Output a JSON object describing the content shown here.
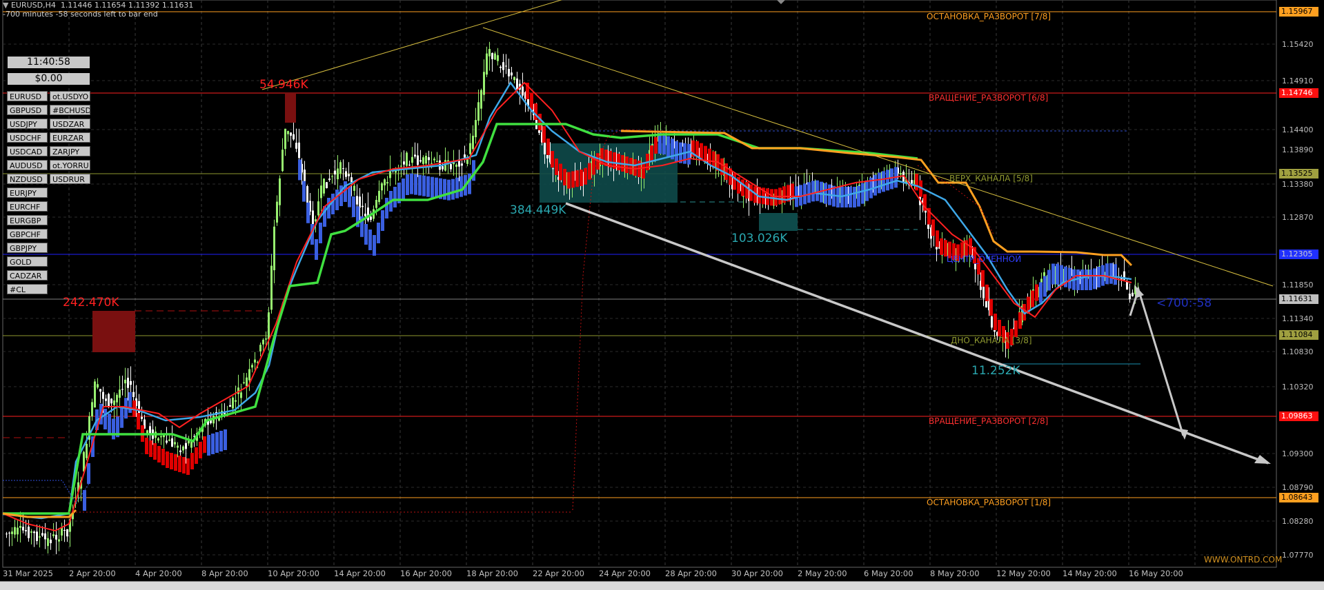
{
  "header": {
    "title": "EURUSD,H4",
    "ohlc": "1.11446 1.11654 1.11392 1.11631",
    "countdown": "-700 minutes -58 seconds left to bar end"
  },
  "panel": {
    "clock": "11:40:58",
    "balance": "$0.00",
    "symbols_col1": [
      "EURUSD",
      "GBPUSD",
      "USDJPY",
      "USDCHF",
      "USDCAD",
      "AUDUSD",
      "NZDUSD",
      "EURJPY",
      "EURCHF",
      "EURGBP",
      "GBPCHF",
      "GBPJPY",
      "GOLD",
      "CADZAR",
      "#CL"
    ],
    "symbols_col2": [
      "ot.USDYO",
      "#BCHUSD",
      "USDZAR",
      "EURZAR",
      "ZARJPY",
      "ot.YORRU",
      "USDRUR"
    ]
  },
  "levels": {
    "l78": "ОСТАНОВКА_РАЗВОРОТ [7/8]",
    "l68": "ВРАЩЕНИЕ_РАЗВОРОТ [6/8]",
    "l58": "ВЕРХ_КАНАЛА [5/8]",
    "l48": "ЦЕНТР_ОЧЕННОЙ",
    "l38": "ДНО_КАНАЛА [3/8]",
    "l28": "ВРАЩЕНИЕ_РАЗВОРОТ [2/8]",
    "l18": "ОСТАНОВКА_РАЗВОРОТ [1/8]"
  },
  "volumes": {
    "v1": "54.946K",
    "v2": "242.470K",
    "v3": "384.449K",
    "v4": "103.026K",
    "v5": "11.252K"
  },
  "timer_label": "<700:-58",
  "watermark": "WWW.ONTRD.COM",
  "price_axis": [
    "1.15420",
    "1.14910",
    "1.14400",
    "1.13890",
    "1.13380",
    "1.12870",
    "1.11850",
    "1.11340",
    "1.10830",
    "1.10320",
    "1.09300",
    "1.08790",
    "1.08280",
    "1.07770"
  ],
  "price_tags": {
    "t1": "1.15967",
    "t2": "1.14746",
    "t3": "1.13525",
    "t4": "1.12305",
    "t5": "1.11631",
    "t6": "1.11084",
    "t7": "1.09863",
    "t8": "1.08643"
  },
  "time_axis": [
    "31 Mar 2025",
    "2 Apr 20:00",
    "4 Apr 20:00",
    "8 Apr 20:00",
    "10 Apr 20:00",
    "14 Apr 20:00",
    "16 Apr 20:00",
    "18 Apr 20:00",
    "22 Apr 20:00",
    "24 Apr 20:00",
    "28 Apr 20:00",
    "30 Apr 20:00",
    "2 May 20:00",
    "6 May 20:00",
    "8 May 20:00",
    "12 May 20:00",
    "14 May 20:00",
    "16 May 20:00"
  ],
  "colors": {
    "bull": "#98f070",
    "bear": "#ffffff",
    "kumo_blue": "#3a5fe0",
    "kumo_red": "#e00000",
    "orange": "#ffa020",
    "green": "#40e040",
    "cyan": "#3ea8e8"
  }
}
